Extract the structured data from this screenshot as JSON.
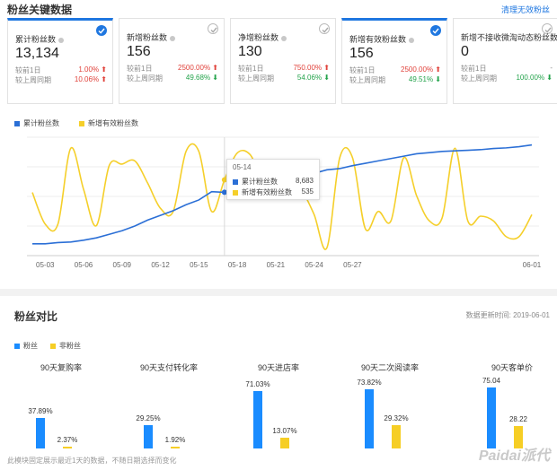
{
  "header": {
    "title": "粉丝关键数据",
    "link": "清理无效粉丝"
  },
  "cards": [
    {
      "label": "累计粉丝数",
      "value": "13,134",
      "checked": true,
      "cmp1_label": "较前1日",
      "cmp1_value": "1.00%",
      "cmp1_dir": "up",
      "cmp2_label": "较上周同期",
      "cmp2_value": "10.06%",
      "cmp2_dir": "up"
    },
    {
      "label": "新增粉丝数",
      "value": "156",
      "checked": false,
      "cmp1_label": "较前1日",
      "cmp1_value": "2500.00%",
      "cmp1_dir": "up",
      "cmp2_label": "较上周同期",
      "cmp2_value": "49.68%",
      "cmp2_dir": "down"
    },
    {
      "label": "净增粉丝数",
      "value": "130",
      "checked": false,
      "cmp1_label": "较前1日",
      "cmp1_value": "750.00%",
      "cmp1_dir": "up",
      "cmp2_label": "较上周同期",
      "cmp2_value": "54.06%",
      "cmp2_dir": "down"
    },
    {
      "label": "新增有效粉丝数",
      "value": "156",
      "checked": true,
      "cmp1_label": "较前1日",
      "cmp1_value": "2500.00%",
      "cmp1_dir": "up",
      "cmp2_label": "较上周同期",
      "cmp2_value": "49.51%",
      "cmp2_dir": "down"
    },
    {
      "label": "新增不接收微淘动态粉丝数",
      "value": "0",
      "checked": false,
      "cmp1_label": "较前1日",
      "cmp1_value": "-",
      "cmp1_dir": "none",
      "cmp2_label": "较上周同期",
      "cmp2_value": "100.00%",
      "cmp2_dir": "down"
    }
  ],
  "colors": {
    "blue": "#2b6fd6",
    "yellow": "#f5cf2a",
    "bar_blue": "#1a8cff",
    "bar_yellow": "#f6ce25"
  },
  "chart_data": [
    {
      "type": "line",
      "series": [
        {
          "name": "累计粉丝数",
          "values": [
            1000,
            1000,
            1100,
            1150,
            1300,
            1500,
            1800,
            2100,
            2500,
            3000,
            3400,
            3800,
            4300,
            4700,
            5400,
            5350,
            6000,
            6150,
            6350,
            6600,
            6550,
            6800,
            6950,
            7250,
            7350,
            7600,
            7800,
            8000,
            8200,
            8400,
            8600,
            8700,
            8800,
            8850,
            8900,
            8950,
            9050,
            9100,
            9200,
            9350
          ]
        },
        {
          "name": "新增有效粉丝数",
          "values": [
            300,
            100,
            100,
            580,
            320,
            90,
            470,
            480,
            500,
            360,
            200,
            180,
            560,
            560,
            180,
            380,
            550,
            540,
            380,
            340,
            500,
            330,
            160,
            -50,
            520,
            520,
            70,
            180,
            120,
            520,
            280,
            120,
            140,
            580,
            120,
            150,
            120,
            20,
            20,
            160
          ]
        }
      ],
      "x_tick_labels": [
        "05-03",
        "05-06",
        "05-09",
        "05-12",
        "05-15",
        "05-18",
        "05-21",
        "05-24",
        "05-27",
        "06-01"
      ],
      "tooltip": {
        "date": "05-14",
        "rows": [
          {
            "name": "累计粉丝数",
            "value": "8,683"
          },
          {
            "name": "新增有效粉丝数",
            "value": "535"
          }
        ]
      }
    },
    {
      "type": "bar",
      "series": [
        {
          "name": "粉丝"
        },
        {
          "name": "非粉丝"
        }
      ],
      "metrics": [
        {
          "title": "90天复购率",
          "fan": 37.89,
          "fan_label": "37.89%",
          "non": 2.37,
          "non_label": "2.37%"
        },
        {
          "title": "90天支付转化率",
          "fan": 29.25,
          "fan_label": "29.25%",
          "non": 1.92,
          "non_label": "1.92%"
        },
        {
          "title": "90天进店率",
          "fan": 71.03,
          "fan_label": "71.03%",
          "non": 13.07,
          "non_label": "13.07%"
        },
        {
          "title": "90天二次阅读率",
          "fan": 73.82,
          "fan_label": "73.82%",
          "non": 29.32,
          "non_label": "29.32%"
        },
        {
          "title": "90天客单价",
          "fan": 75.04,
          "fan_label": "75.04",
          "non": 28.22,
          "non_label": "28.22"
        }
      ]
    }
  ],
  "compare": {
    "title": "粉丝对比",
    "updated": "数据更新时间: 2019-06-01"
  },
  "footnote": "此模块固定展示最近1天的数据，不随日期选择而变化",
  "watermark": "Paidai派代"
}
